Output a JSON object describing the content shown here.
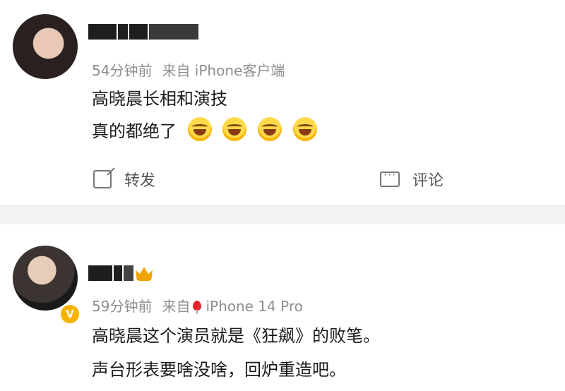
{
  "posts": [
    {
      "meta": {
        "time": "54分钟前",
        "source": "来自 iPhone客户端"
      },
      "content": {
        "line1": "高晓晨长相和演技",
        "line2": "真的都绝了"
      },
      "emojis": [
        "laugh-emoji",
        "laugh-emoji",
        "laugh-emoji",
        "laugh-emoji"
      ],
      "actions": {
        "repost": "转发",
        "comment": "评论"
      }
    },
    {
      "meta": {
        "time": "59分钟前",
        "source_prefix": "来自",
        "source": "iPhone 14 Pro"
      },
      "content": {
        "line1": "高晓晨这个演员就是《狂飙》的败笔。",
        "line2": "声台形表要啥没啥，回炉重造吧。"
      },
      "verified_badge": "V"
    }
  ],
  "colors": {
    "separator": "#f2f2f2",
    "meta_text": "#8e8e8e",
    "badge": "#f5b400",
    "location_pin": "#e8262e"
  }
}
